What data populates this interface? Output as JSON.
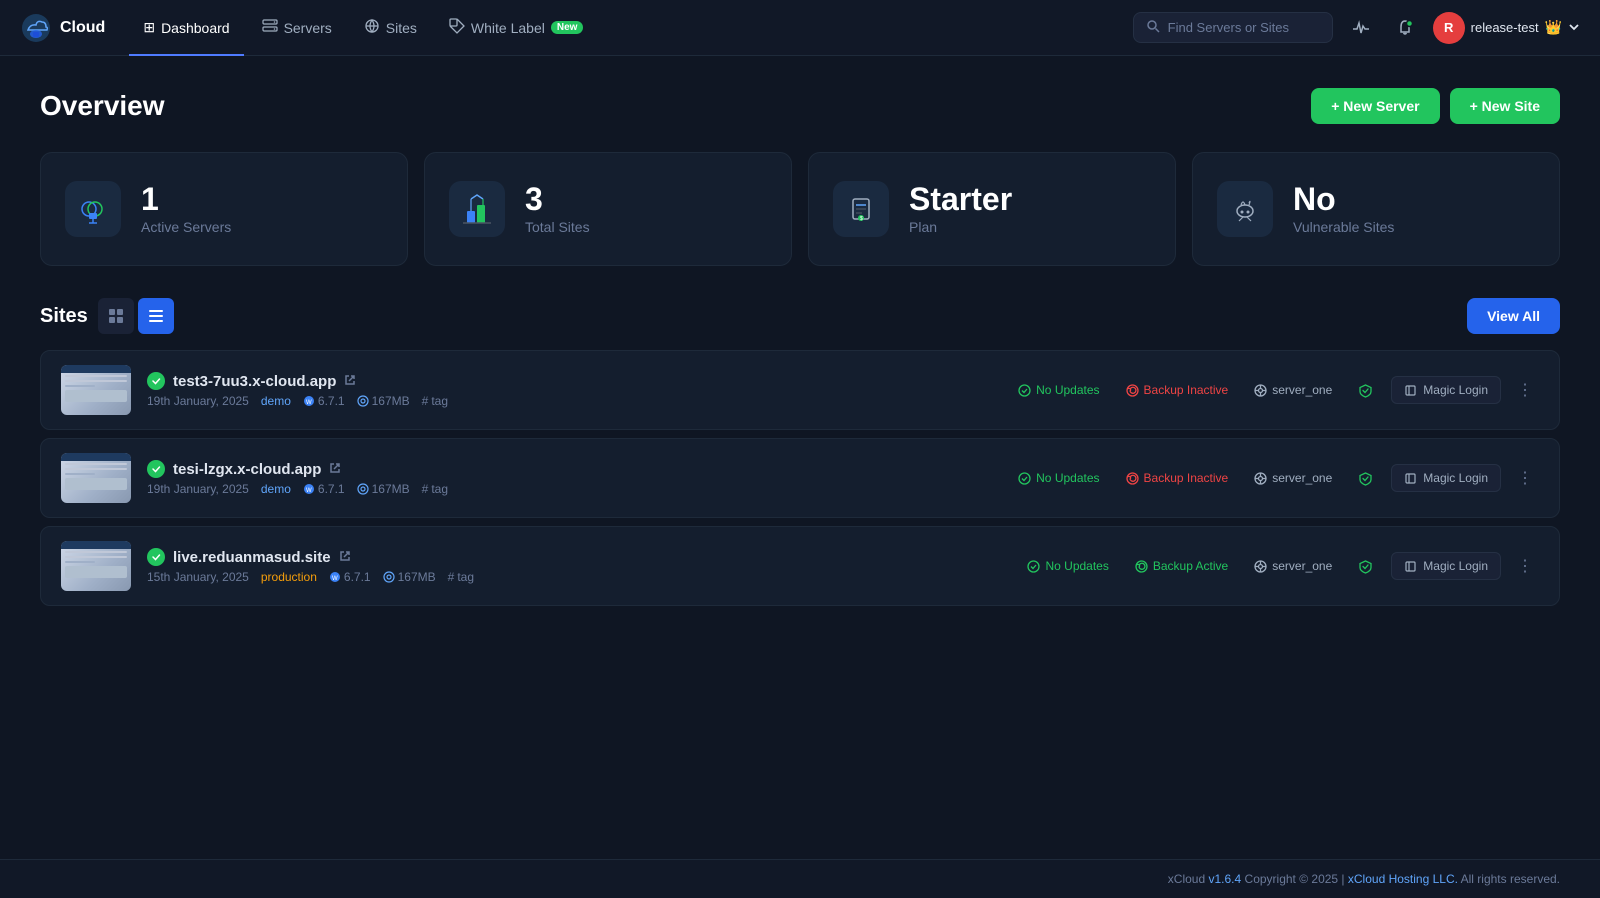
{
  "app": {
    "logo_text": "Cloud",
    "logo_icon": "☁"
  },
  "nav": {
    "items": [
      {
        "id": "dashboard",
        "label": "Dashboard",
        "active": true,
        "icon": "⊞"
      },
      {
        "id": "servers",
        "label": "Servers",
        "active": false,
        "icon": "🖥"
      },
      {
        "id": "sites",
        "label": "Sites",
        "active": false,
        "icon": "🌐"
      },
      {
        "id": "white-label",
        "label": "White Label",
        "active": false,
        "icon": "🏷",
        "badge": "New"
      }
    ],
    "search_placeholder": "Find Servers or Sites",
    "user": {
      "name": "release-test",
      "avatar_initial": "R",
      "emoji": "👑"
    }
  },
  "page": {
    "title": "Overview",
    "new_server_label": "+ New Server",
    "new_site_label": "+ New Site"
  },
  "stats": [
    {
      "id": "active-servers",
      "number": "1",
      "label": "Active Servers",
      "icon": "🌐"
    },
    {
      "id": "total-sites",
      "number": "3",
      "label": "Total Sites",
      "icon": "🔗"
    },
    {
      "id": "plan",
      "number": "Starter",
      "label": "Plan",
      "icon": "💵"
    },
    {
      "id": "vulnerable-sites",
      "number": "No",
      "label": "Vulnerable Sites",
      "icon": "🐛"
    }
  ],
  "sites_section": {
    "title": "Sites",
    "view_all_label": "View All",
    "sites": [
      {
        "id": "site1",
        "name": "test3-7uu3.x-cloud.app",
        "date": "19th January, 2025",
        "tag": "demo",
        "tag_type": "demo",
        "wp_version": "6.7.1",
        "disk": "167MB",
        "tag_label": "tag",
        "updates": "No Updates",
        "backup": "Backup Inactive",
        "backup_active": false,
        "server": "server_one",
        "status": "active"
      },
      {
        "id": "site2",
        "name": "tesi-lzgx.x-cloud.app",
        "date": "19th January, 2025",
        "tag": "demo",
        "tag_type": "demo",
        "wp_version": "6.7.1",
        "disk": "167MB",
        "tag_label": "tag",
        "updates": "No Updates",
        "backup": "Backup Inactive",
        "backup_active": false,
        "server": "server_one",
        "status": "active"
      },
      {
        "id": "site3",
        "name": "live.reduanmasud.site",
        "date": "15th January, 2025",
        "tag": "production",
        "tag_type": "production",
        "wp_version": "6.7.1",
        "disk": "167MB",
        "tag_label": "tag",
        "updates": "No Updates",
        "backup": "Backup Active",
        "backup_active": true,
        "server": "server_one",
        "status": "active"
      }
    ],
    "magic_login_label": "Magic Login"
  },
  "footer": {
    "text": "xCloud",
    "version": "v1.6.4",
    "copyright": "Copyright © 2025 |",
    "company": "xCloud Hosting LLC.",
    "rights": "All rights reserved."
  }
}
